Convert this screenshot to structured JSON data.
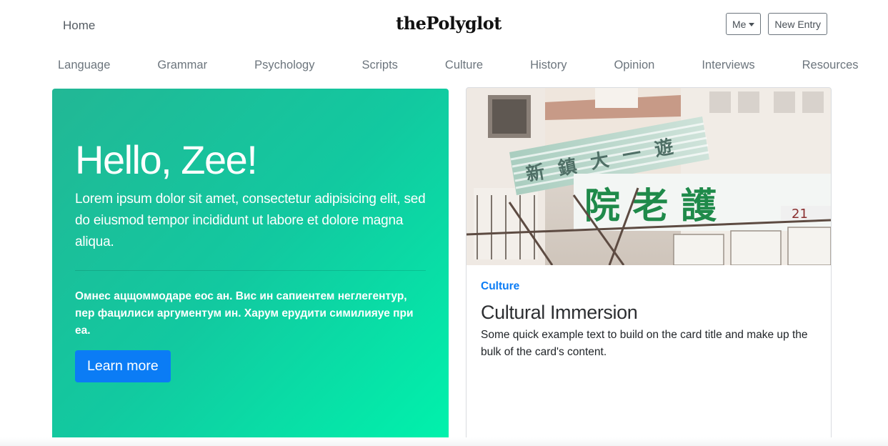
{
  "header": {
    "home_label": "Home",
    "brand": "thePolyglot",
    "me_label": "Me",
    "new_entry_label": "New Entry"
  },
  "categories": [
    {
      "label": "Language"
    },
    {
      "label": "Grammar"
    },
    {
      "label": "Psychology"
    },
    {
      "label": "Scripts"
    },
    {
      "label": "Culture"
    },
    {
      "label": "History"
    },
    {
      "label": "Opinion"
    },
    {
      "label": "Interviews"
    },
    {
      "label": "Resources"
    }
  ],
  "hero": {
    "title": "Hello, Zee!",
    "lead": "Lorem ipsum dolor sit amet, consectetur adipisicing elit, sed do eiusmod tempor incididunt ut labore et dolore magna aliqua.",
    "body": "Омнес ацщоммодаре еос ан. Вис ин сапиентем неглегентур, пер фацилиси аргументум ин. Харум ерудити симилияуе при еа.",
    "button_label": "Learn more",
    "gradient_start": "#22b795",
    "gradient_end": "#00f2ac"
  },
  "card": {
    "category": "Culture",
    "title": "Cultural Immersion",
    "text": "Some quick example text to build on the card title and make up the bulk of the card's content.",
    "image_sign_text": "院 老 護",
    "image_sign_number": "21",
    "accent_color": "#0b7cf5"
  }
}
